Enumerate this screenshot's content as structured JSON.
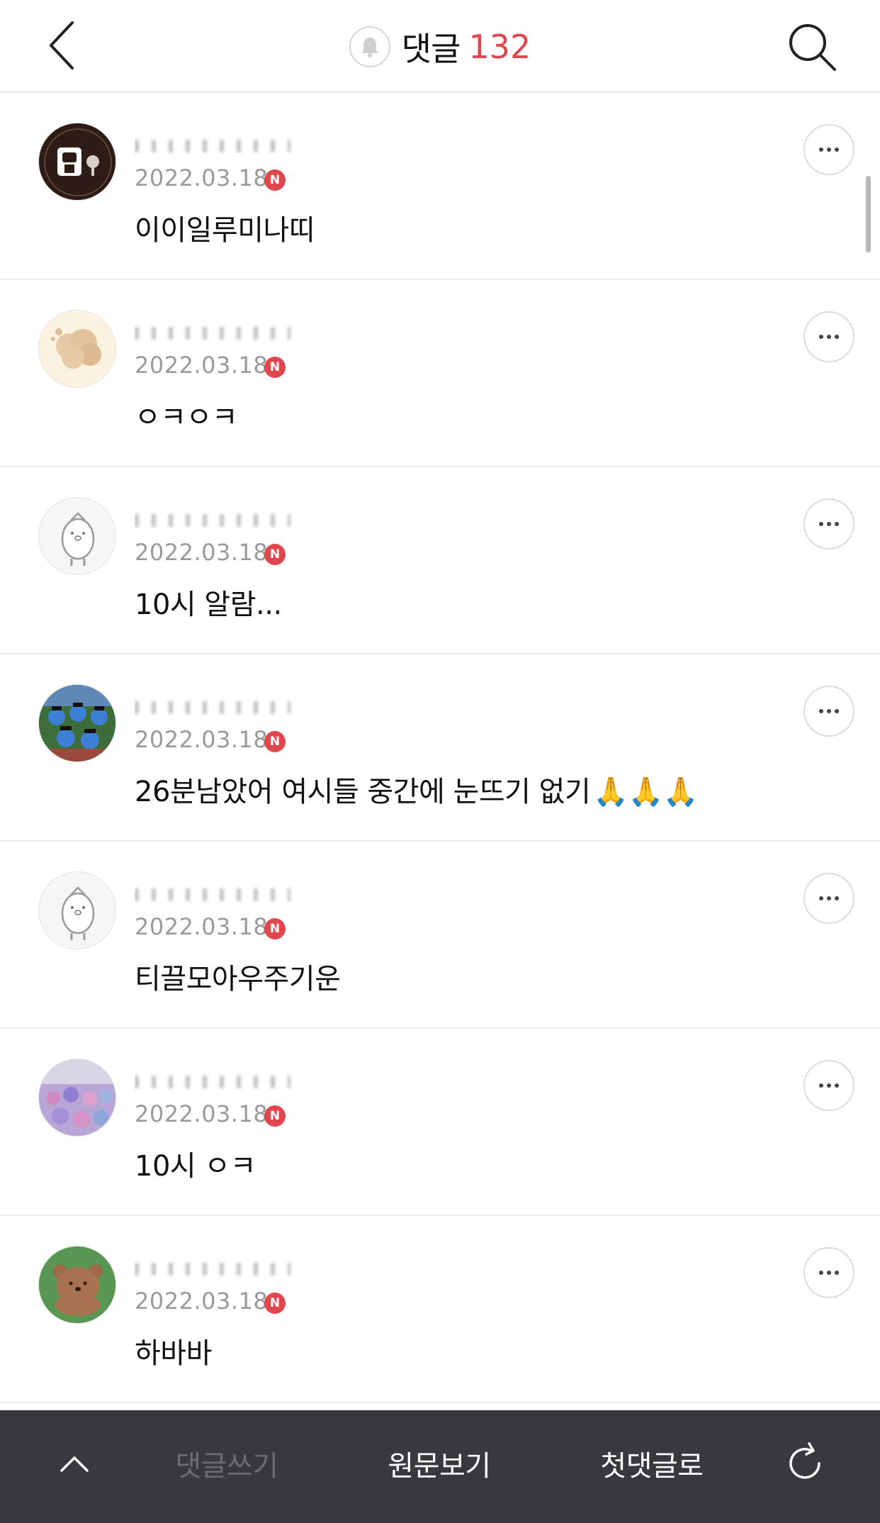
{
  "header": {
    "title": "댓글",
    "count": "132",
    "back_icon": "chevron-left-icon",
    "bell_icon": "bell-icon",
    "search_icon": "search-icon"
  },
  "comments": [
    {
      "date": "2022.03.18",
      "badge": "N",
      "text": "이이일루미나띠",
      "avatar": "bam-logo"
    },
    {
      "date": "2022.03.18",
      "badge": "N",
      "text": "ㅇㅋㅇㅋ",
      "avatar": "cloud-character"
    },
    {
      "date": "2022.03.18",
      "badge": "N",
      "text": "10시 알람...",
      "avatar": "penguin-default"
    },
    {
      "date": "2022.03.18",
      "badge": "N",
      "text": "26분남았어 여시들 중간에 눈뜨기 없기",
      "emoji": "🙏🙏🙏",
      "avatar": "crowd-cartoon"
    },
    {
      "date": "2022.03.18",
      "badge": "N",
      "text": "티끌모아우주기운",
      "avatar": "penguin-default"
    },
    {
      "date": "2022.03.18",
      "badge": "N",
      "text": "10시 ㅇㅋ",
      "avatar": "flower-field"
    },
    {
      "date": "2022.03.18",
      "badge": "N",
      "text": "하바바",
      "avatar": "bear-character"
    }
  ],
  "bottom_bar": {
    "write_label": "댓글쓰기",
    "original_label": "원문보기",
    "first_label": "첫댓글로"
  },
  "colors": {
    "accent": "#e0474c",
    "bottom_bar": "#38393d",
    "date_gray": "#9a9a9a"
  }
}
